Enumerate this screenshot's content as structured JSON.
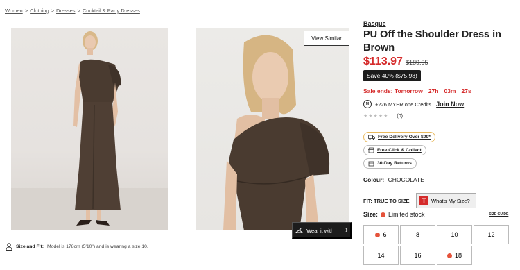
{
  "breadcrumb": {
    "items": [
      "Women",
      "Clothing",
      "Dresses",
      "Cocktail & Party Dresses"
    ],
    "separator": ">"
  },
  "gallery": {
    "view_similar": "View Similar",
    "wear_it_with": "Wear it with"
  },
  "size_fit": {
    "label": "Size and Fit:",
    "text": "Model is 178cm (5'10\") and is wearing a size 10."
  },
  "product": {
    "brand": "Basque",
    "title": "PU Off the Shoulder Dress in Brown",
    "price": "$113.97",
    "was_price": "$189.95",
    "save": "Save 40% ($75.98)",
    "sale_ends_label": "Sale ends: Tomorrow",
    "countdown": [
      "27h",
      "03m",
      "27s"
    ],
    "credits_text": "+226 MYER one Credits.",
    "credits_coin": "M",
    "join_now": "Join Now",
    "stars": "★★★★★",
    "review_count": "(0)",
    "delivery": "Free Delivery Over $99*",
    "click_collect": "Free Click & Collect",
    "returns": "30-Day Returns",
    "colour_label": "Colour:",
    "colour_value": "CHOCOLATE",
    "fit_label": "FIT: TRUE TO SIZE",
    "whats_my_size": "What's My Size?",
    "whats_my_size_badge": "T",
    "size_label": "Size:",
    "stock_status": "Limited stock",
    "size_guide": "SIZE GUIDE",
    "sizes": [
      {
        "label": "6",
        "limited": true
      },
      {
        "label": "8",
        "limited": false
      },
      {
        "label": "10",
        "limited": false
      },
      {
        "label": "12",
        "limited": false
      },
      {
        "label": "14",
        "limited": false
      },
      {
        "label": "16",
        "limited": false
      },
      {
        "label": "18",
        "limited": true
      }
    ]
  },
  "colors": {
    "accent_red": "#d52b2b",
    "limited_dot": "#e5533b",
    "dark": "#1c1c1c",
    "delivery_border": "#e8b85c"
  }
}
